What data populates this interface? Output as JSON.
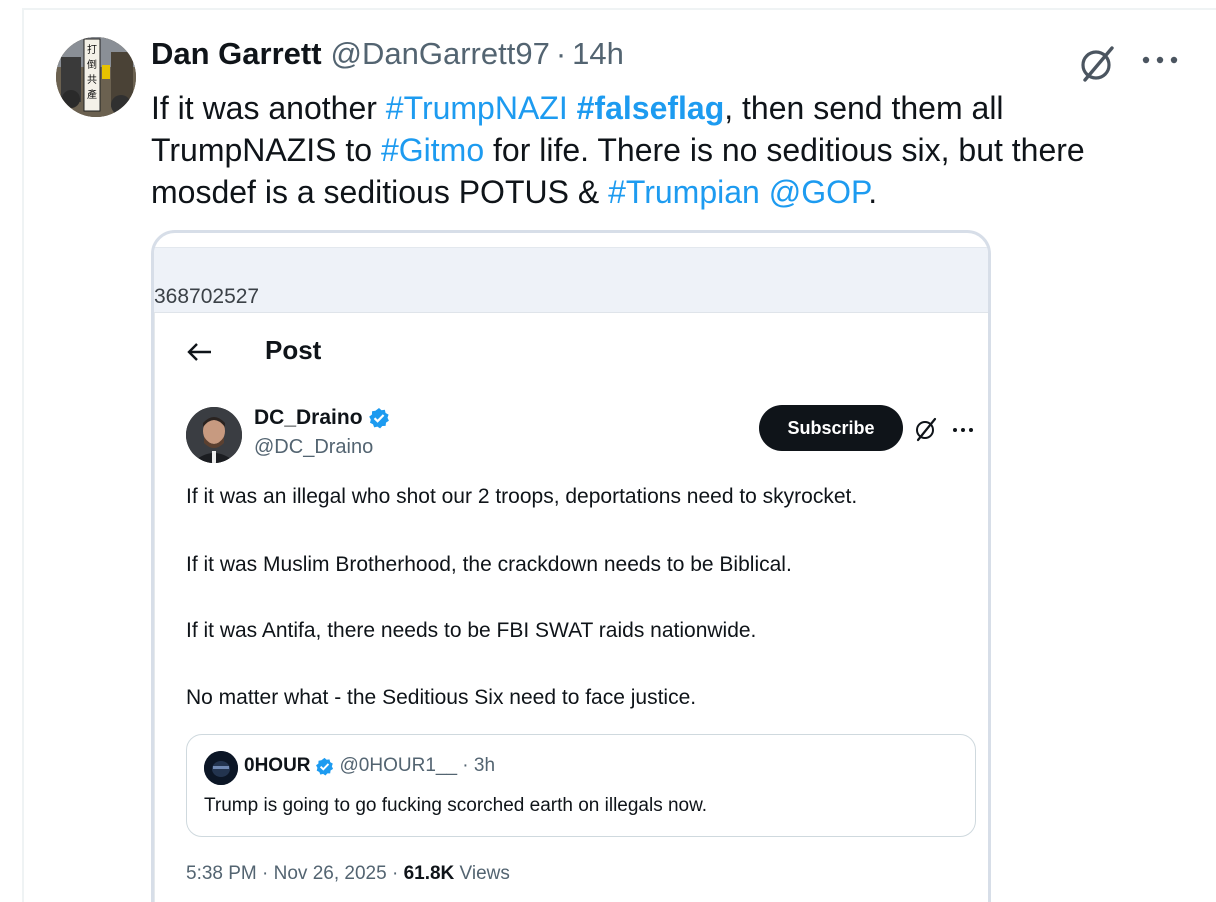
{
  "tweet": {
    "author_name": "Dan Garrett",
    "author_handle": "@DanGarrett97",
    "separator": "·",
    "time": "14h",
    "text_parts": {
      "t1": "If it was another ",
      "h1": "#TrumpNAZI",
      "s1": " ",
      "h2": "#falseflag",
      "t2": ", then send them all TrumpNAZIS to ",
      "h3": "#Gitmo",
      "t3": " for life. There is no seditious six, but there mosdef is a seditious POTUS & ",
      "h4": "#Trumpian",
      "s2": " ",
      "h5": "@GOP",
      "t4": "."
    },
    "icons": {
      "avatar": "profile-photo",
      "grok": "grok-icon",
      "more": "more-icon"
    }
  },
  "media": {
    "url_fragment": "368702527",
    "post_header": "Post",
    "embedded_tweet": {
      "author_name": "DC_Draino",
      "author_handle": "@DC_Draino",
      "subscribe_label": "Subscribe",
      "paragraphs": [
        "If it was an illegal who shot our 2 troops, deportations need to skyrocket.",
        "If it was Muslim Brotherhood, the crackdown needs to be Biblical.",
        "If it was Antifa, there needs to be FBI SWAT raids nationwide.",
        "No matter what - the Seditious Six need to face justice."
      ],
      "quoted": {
        "author_name": "0HOUR",
        "meta": "@0HOUR1__ · 3h",
        "text": "Trump is going to go fucking scorched earth on illegals now."
      },
      "timestamp": "5:38 PM · Nov 26, 2025 · ",
      "views_count": "61.8K",
      "views_label": " Views"
    }
  },
  "colors": {
    "link": "#1d9bf0",
    "verified": "#1d9bf0",
    "text": "#0f1419",
    "muted": "#536471"
  }
}
